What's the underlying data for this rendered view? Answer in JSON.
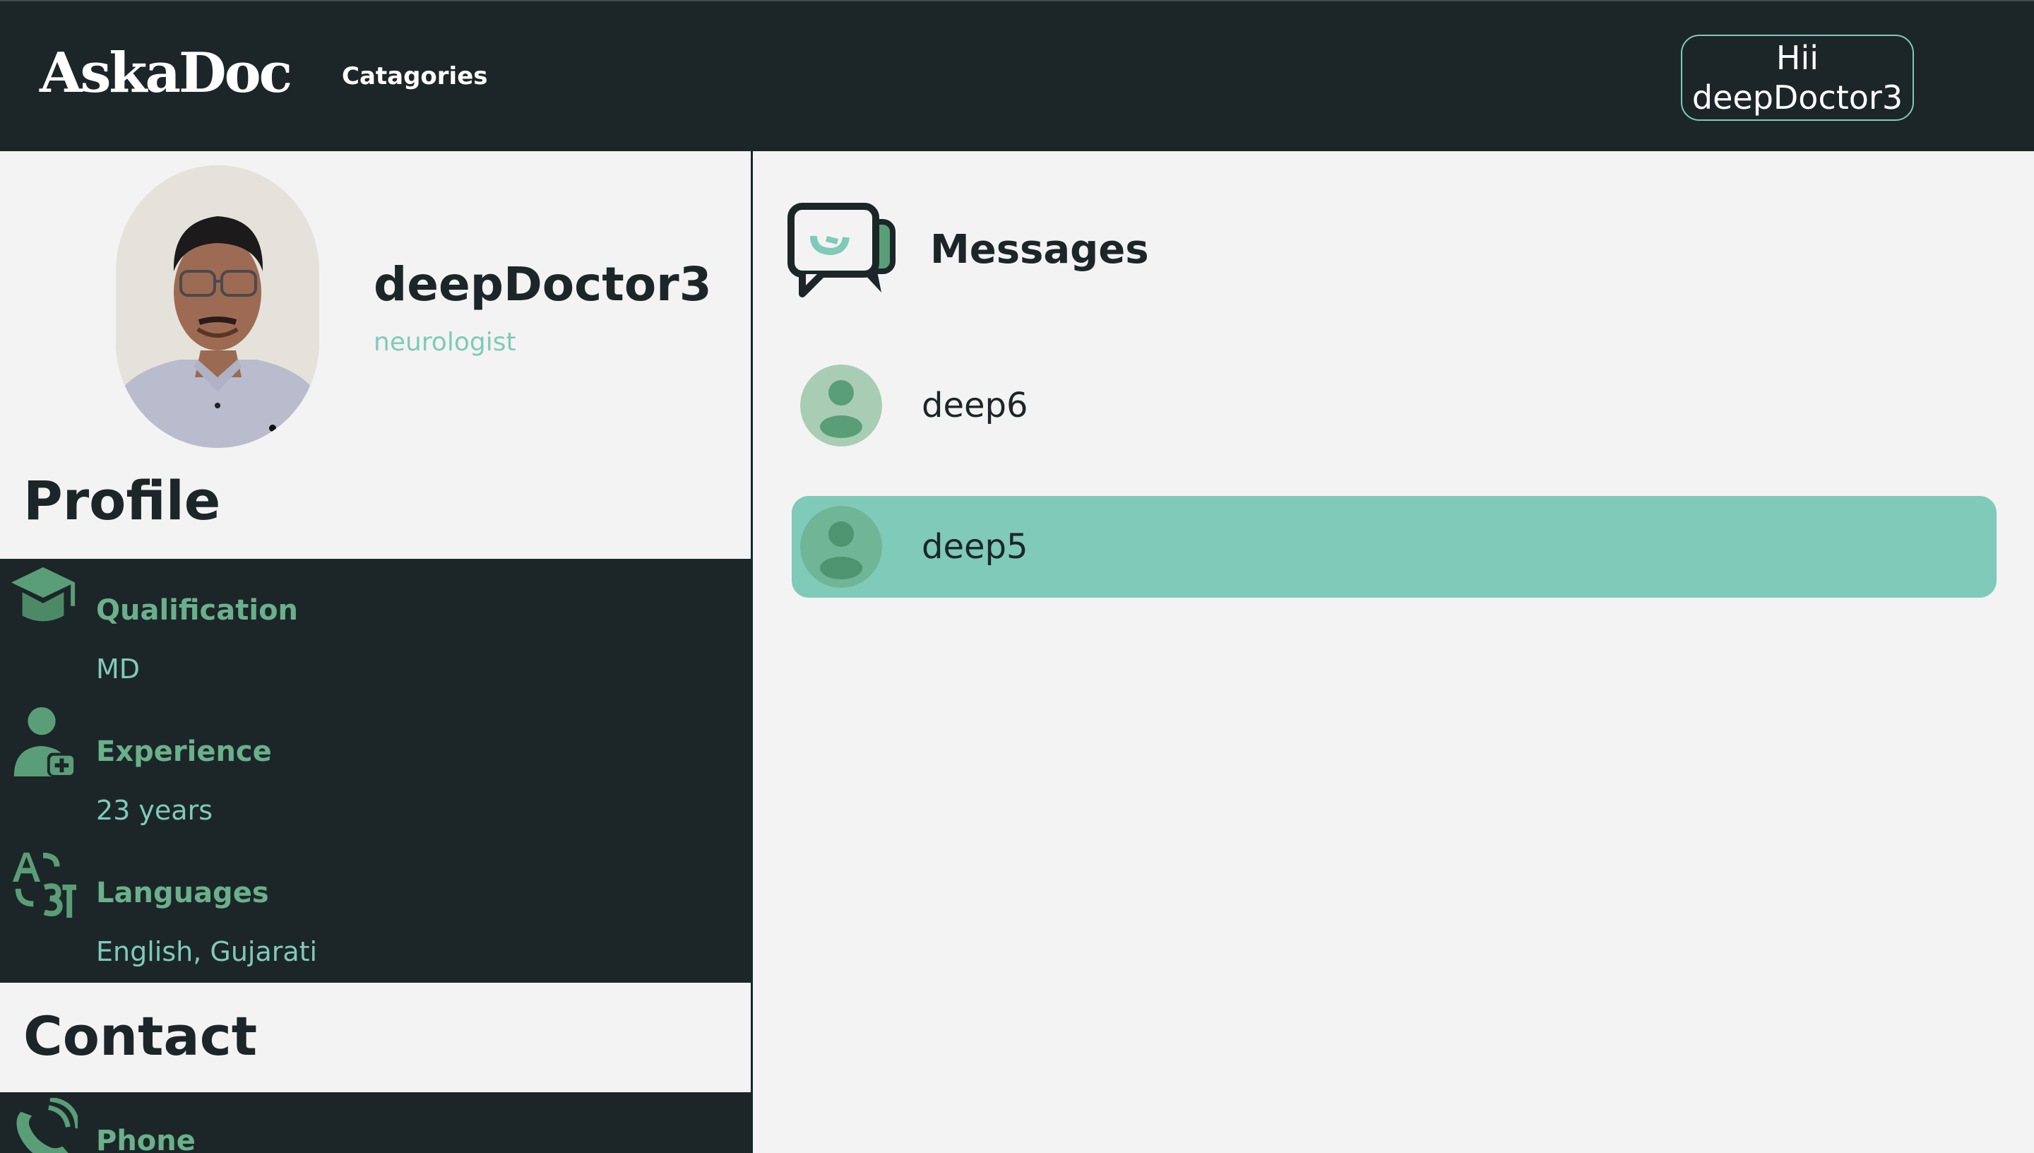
{
  "navbar": {
    "brand": "AskaDoc",
    "categories_link": "Catagories",
    "greeting_line1": "Hii",
    "greeting_line2": "deepDoctor3"
  },
  "profile": {
    "doctor_name": "deepDoctor3",
    "specialty": "neurologist",
    "section_title": "Profile",
    "items": [
      {
        "label": "Qualification",
        "value": "MD",
        "icon": "graduation-cap-icon"
      },
      {
        "label": "Experience",
        "value": "23 years",
        "icon": "doctor-user-icon"
      },
      {
        "label": "Languages",
        "value": "English, Gujarati",
        "icon": "translate-icon"
      }
    ]
  },
  "contact": {
    "section_title": "Contact",
    "items": [
      {
        "label": "Phone",
        "icon": "phone-icon"
      }
    ]
  },
  "messages": {
    "title": "Messages",
    "icon": "chat-bubbles-icon",
    "conversations": [
      {
        "name": "deep6",
        "active": false
      },
      {
        "name": "deep5",
        "active": true
      }
    ]
  },
  "colors": {
    "dark": "#1c2629",
    "accent": "#7fcab9",
    "icon_green": "#5a9e78",
    "background": "#f3f3f3"
  }
}
